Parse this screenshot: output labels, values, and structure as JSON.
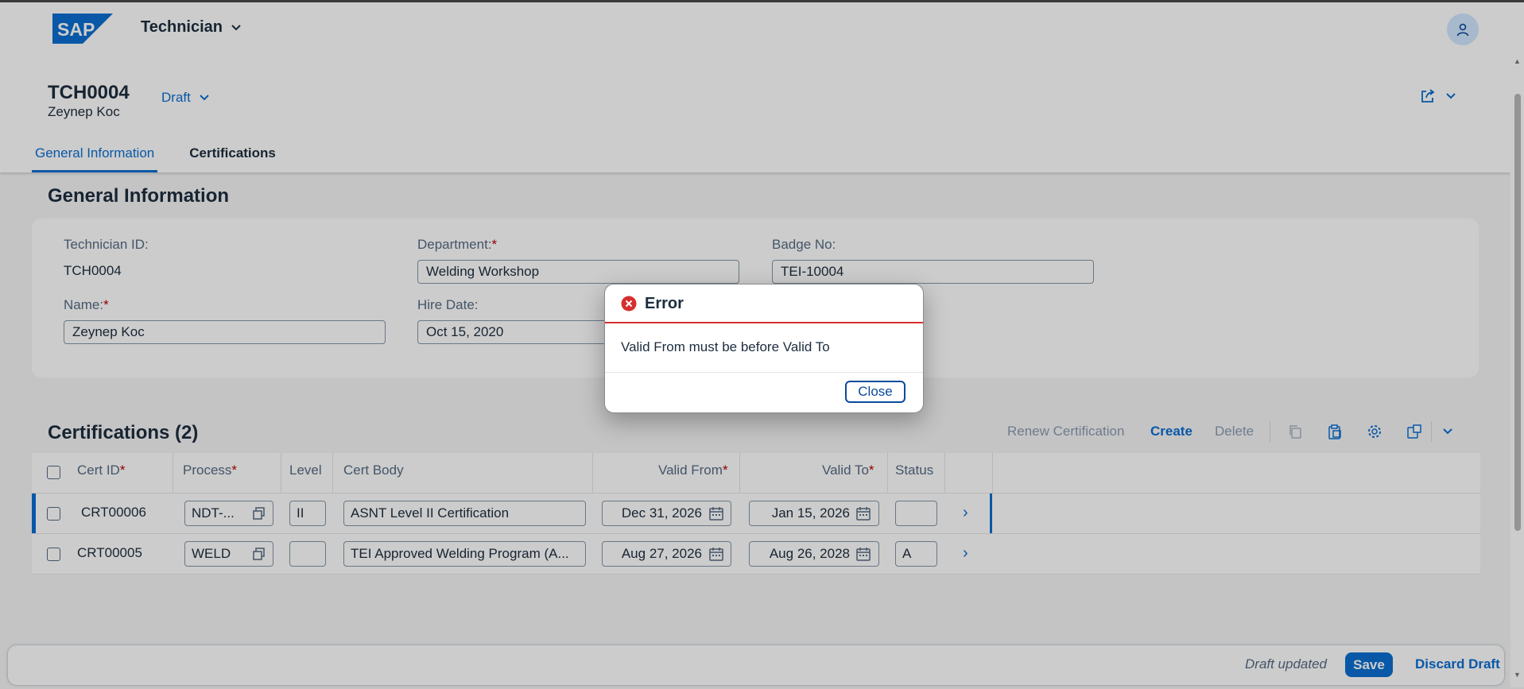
{
  "shell": {
    "app_title": "Technician",
    "logo_text": "SAP"
  },
  "header": {
    "title": "TCH0004",
    "subtitle": "Zeynep Koc",
    "draft_label": "Draft",
    "tabs": [
      {
        "label": "General Information"
      },
      {
        "label": "Certifications"
      }
    ]
  },
  "general": {
    "section_title": "General Information",
    "technician_id_label": "Technician ID:",
    "technician_id_value": "TCH0004",
    "department_label": "Department:",
    "department_value": "Welding Workshop",
    "badge_label": "Badge No:",
    "badge_value": "TEI-10004",
    "name_label": "Name:",
    "name_value": "Zeynep Koc",
    "hire_date_label": "Hire Date:",
    "hire_date_value": "Oct 15, 2020",
    "required_mark": "*"
  },
  "certifications": {
    "section_title": "Certifications",
    "count": "(2)",
    "toolbar": {
      "renew": "Renew Certification",
      "create": "Create",
      "delete": "Delete"
    },
    "columns": [
      "Cert ID",
      "Process",
      "Level",
      "Cert Body",
      "Valid From",
      "Valid To",
      "Status"
    ],
    "rows": [
      {
        "cert_id": "CRT00006",
        "process": "NDT-...",
        "level": "II",
        "cert_body": "ASNT Level II Certification",
        "valid_from": "Dec 31, 2026",
        "valid_to": "Jan 15, 2026",
        "status": ""
      },
      {
        "cert_id": "CRT00005",
        "process": "WELD",
        "level": "",
        "cert_body": "TEI Approved Welding Program (A...",
        "valid_from": "Aug 27, 2026",
        "valid_to": "Aug 26, 2028",
        "status": "A"
      }
    ]
  },
  "footer": {
    "status": "Draft updated",
    "save": "Save",
    "discard": "Discard Draft"
  },
  "dialog": {
    "title": "Error",
    "message": "Valid From must be before Valid To",
    "close": "Close"
  },
  "colors": {
    "accent": "#0a6ed1",
    "error": "#d62f2f",
    "required": "#bb0000"
  }
}
